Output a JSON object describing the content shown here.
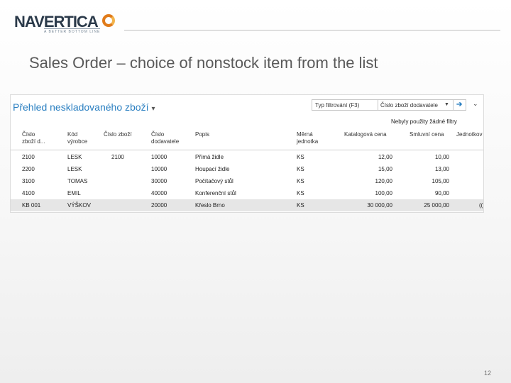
{
  "brand": {
    "name": "NAVERTICA",
    "tagline": "A BETTER BOTTOM LINE"
  },
  "slide": {
    "title": "Sales Order – choice of nonstock item from the list",
    "page_number": "12"
  },
  "app": {
    "page_title": "Přehled neskladovaného zboží",
    "filter": {
      "type_label": "Typ filtrování (F3)",
      "field_label": "Číslo zboží dodavatele",
      "no_filters": "Nebyly použity žádné filtry"
    },
    "columns": [
      {
        "l1": "Číslo",
        "l2": "zboží d..."
      },
      {
        "l1": "Kód",
        "l2": "výrobce"
      },
      {
        "l1": "Číslo zboží",
        "l2": ""
      },
      {
        "l1": "Číslo",
        "l2": "dodavatele"
      },
      {
        "l1": "Popis",
        "l2": ""
      },
      {
        "l1": "Měrná",
        "l2": "jednotka"
      },
      {
        "l1": "Katalogová cena",
        "l2": ""
      },
      {
        "l1": "Smluvní cena",
        "l2": ""
      },
      {
        "l1": "Jednotkov",
        "l2": ""
      }
    ],
    "rows": [
      [
        "2100",
        "LESK",
        "2100",
        "10000",
        "Přímá židle",
        "KS",
        "12,00",
        "10,00",
        ""
      ],
      [
        "2200",
        "LESK",
        "",
        "10000",
        "Houpací židle",
        "KS",
        "15,00",
        "13,00",
        ""
      ],
      [
        "3100",
        "TOMAS",
        "",
        "30000",
        "Počítačový stůl",
        "KS",
        "120,00",
        "105,00",
        ""
      ],
      [
        "4100",
        "EMIL",
        "",
        "40000",
        "Konferenční stůl",
        "KS",
        "100,00",
        "90,00",
        ""
      ],
      [
        "KB 001",
        "VÝŠKOV",
        "",
        "20000",
        "Křeslo Brno",
        "KS",
        "30 000,00",
        "25 000,00",
        "(("
      ]
    ],
    "selected_row_index": 4
  }
}
